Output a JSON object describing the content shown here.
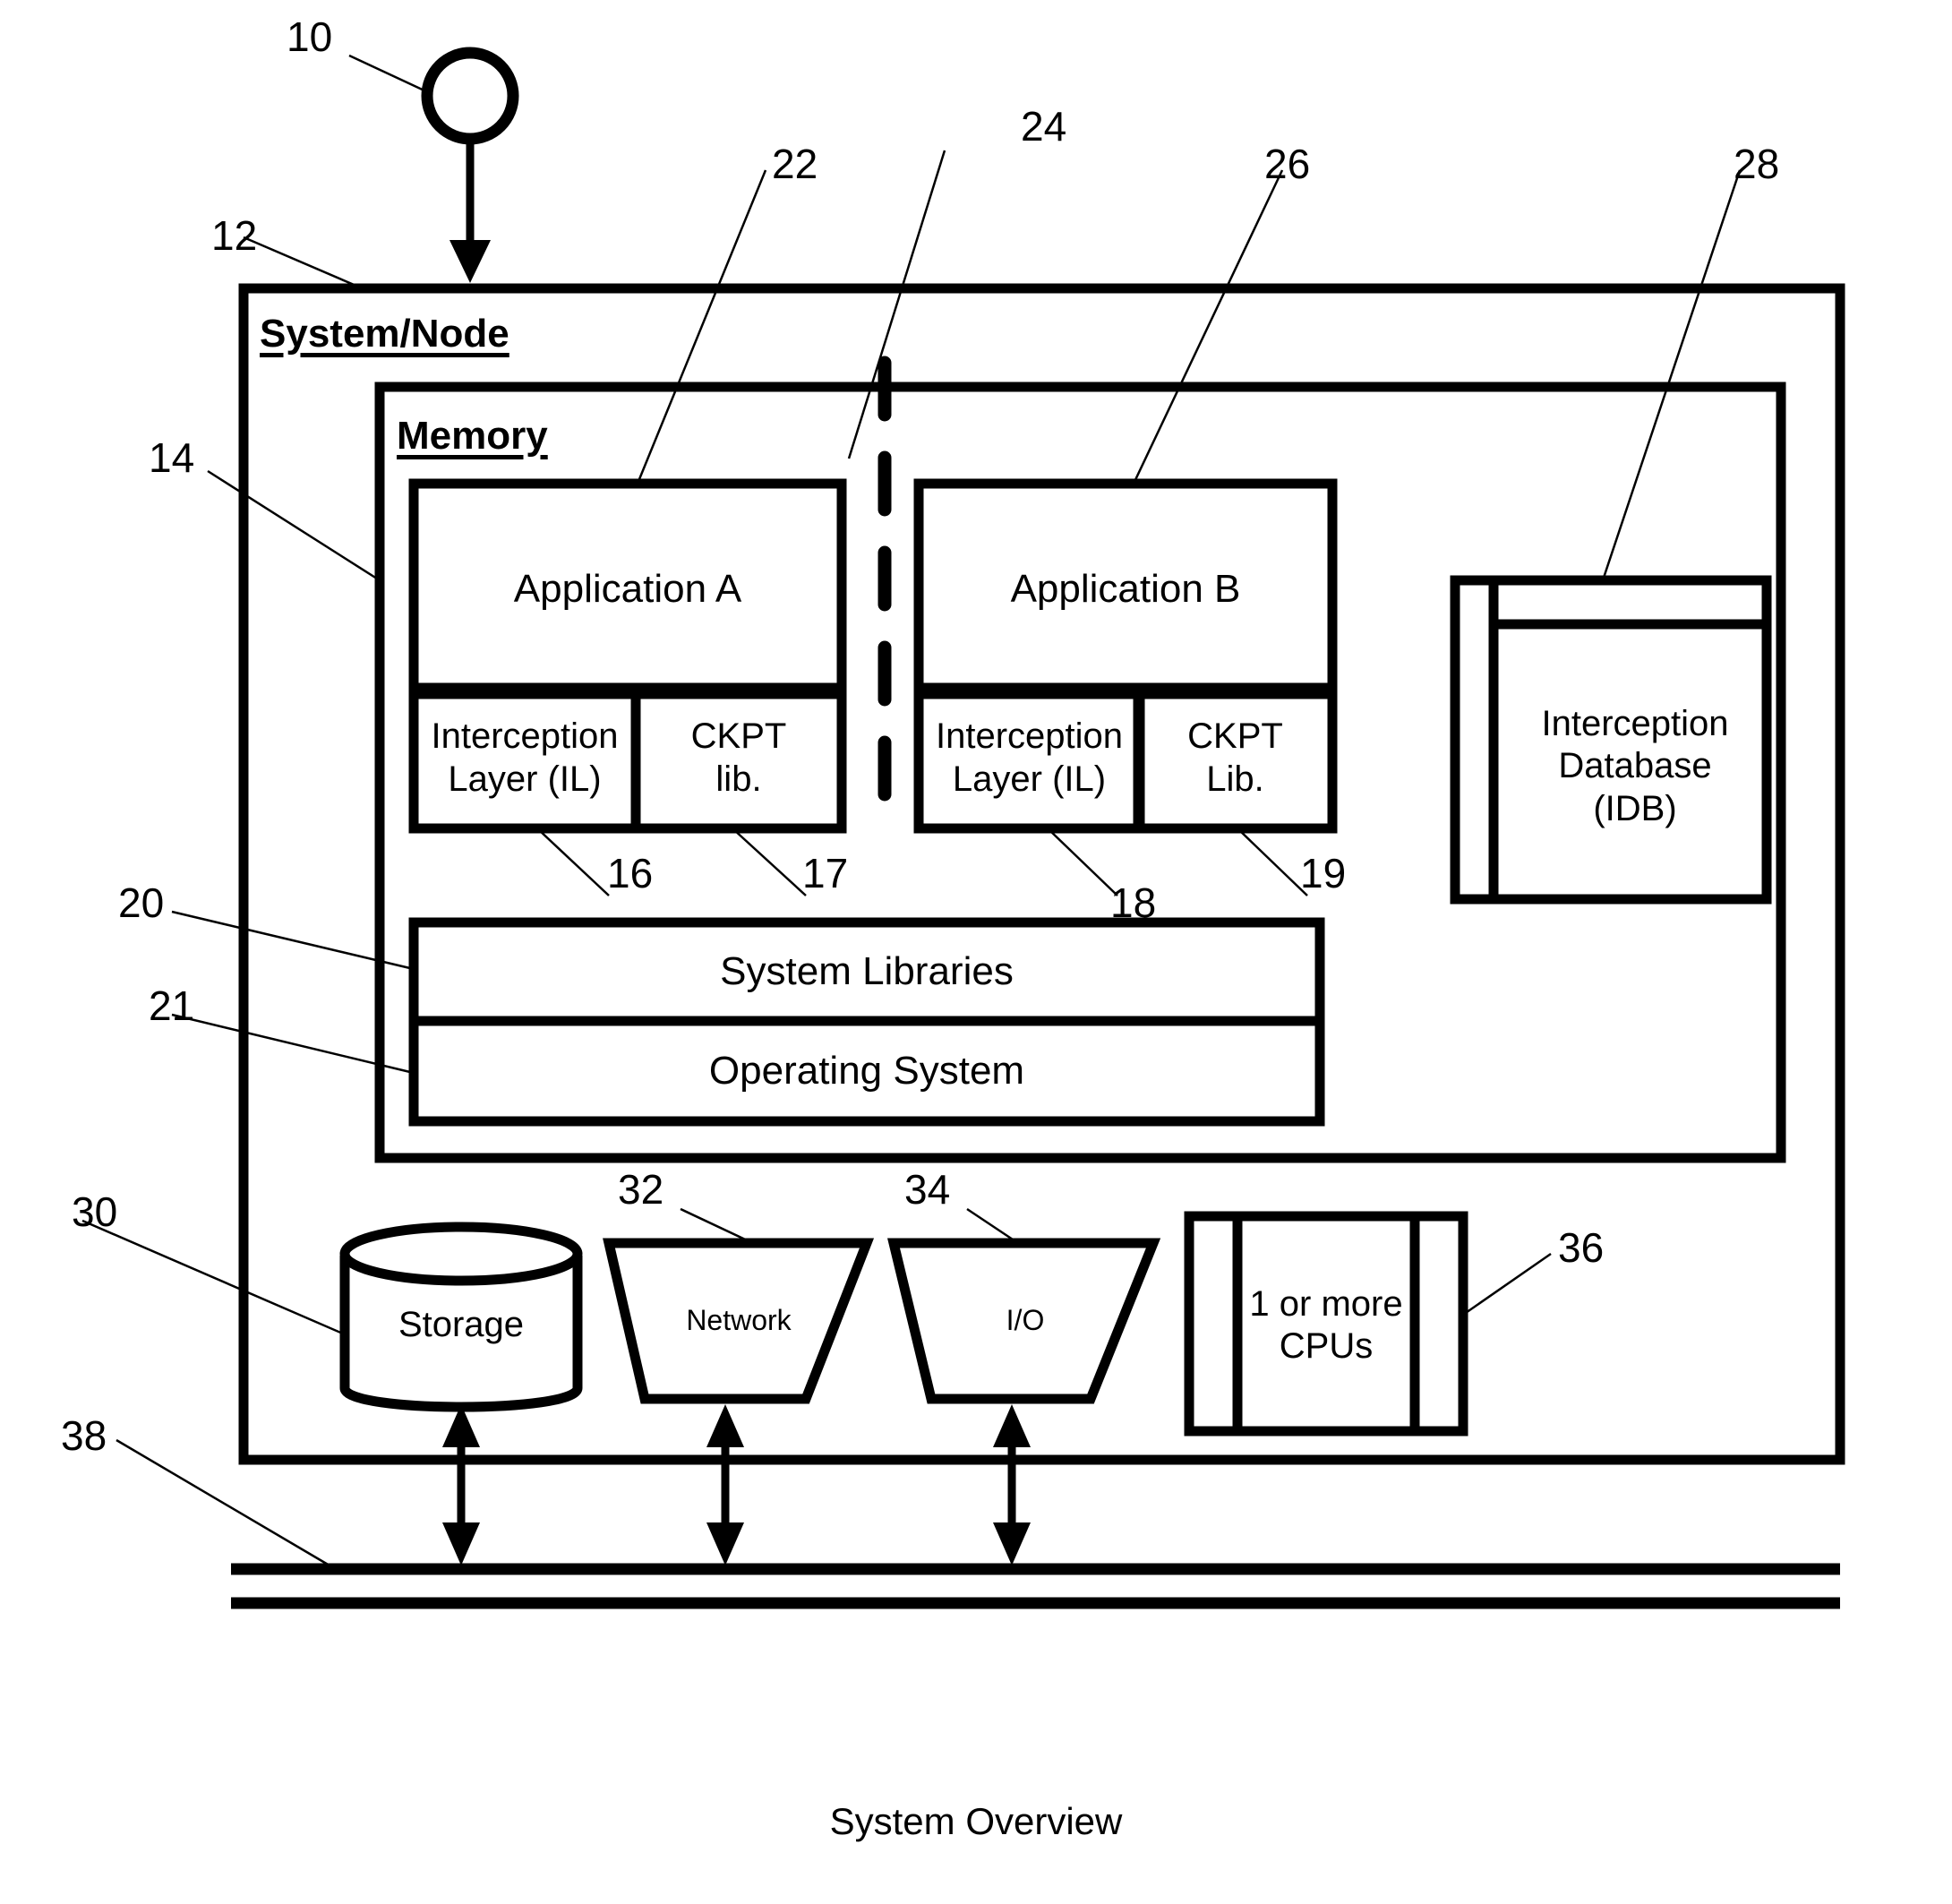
{
  "figure": {
    "caption": "System Overview",
    "stroke_color": "#000000",
    "background_color": "#ffffff"
  },
  "containers": {
    "system_node": {
      "title": "System/Node",
      "ref": "12"
    },
    "memory": {
      "title": "Memory",
      "ref": "14"
    }
  },
  "user_actor": {
    "ref": "10",
    "shape": "circle"
  },
  "applications": [
    {
      "ref": "22",
      "name": "Application A",
      "interception_layer": {
        "ref": "16",
        "label": "Interception\nLayer (IL)"
      },
      "ckpt": {
        "ref": "17",
        "label": "CKPT\nlib."
      }
    },
    {
      "ref": "26",
      "name": "Application B",
      "interception_layer": {
        "ref": "18",
        "label": "Interception\nLayer (IL)"
      },
      "ckpt": {
        "ref": "19",
        "label": "CKPT\nLib."
      }
    }
  ],
  "separator": {
    "ref": "24",
    "style": "dashed-vertical"
  },
  "interception_database": {
    "ref": "28",
    "label": "Interception\nDatabase\n(IDB)"
  },
  "stack": [
    {
      "ref": "20",
      "label": "System Libraries"
    },
    {
      "ref": "21",
      "label": "Operating System"
    }
  ],
  "hardware": [
    {
      "ref": "30",
      "label": "Storage",
      "shape": "cylinder"
    },
    {
      "ref": "32",
      "label": "Network",
      "shape": "trapezoid"
    },
    {
      "ref": "34",
      "label": "I/O",
      "shape": "trapezoid"
    },
    {
      "ref": "36",
      "label": "1 or more\nCPUs",
      "shape": "chip"
    }
  ],
  "bus": {
    "ref": "38",
    "style": "double-line"
  },
  "ref_numbers": {
    "n10": "10",
    "n12": "12",
    "n14": "14",
    "n16": "16",
    "n17": "17",
    "n18": "18",
    "n19": "19",
    "n20": "20",
    "n21": "21",
    "n22": "22",
    "n24": "24",
    "n26": "26",
    "n28": "28",
    "n30": "30",
    "n32": "32",
    "n34": "34",
    "n36": "36",
    "n38": "38"
  }
}
